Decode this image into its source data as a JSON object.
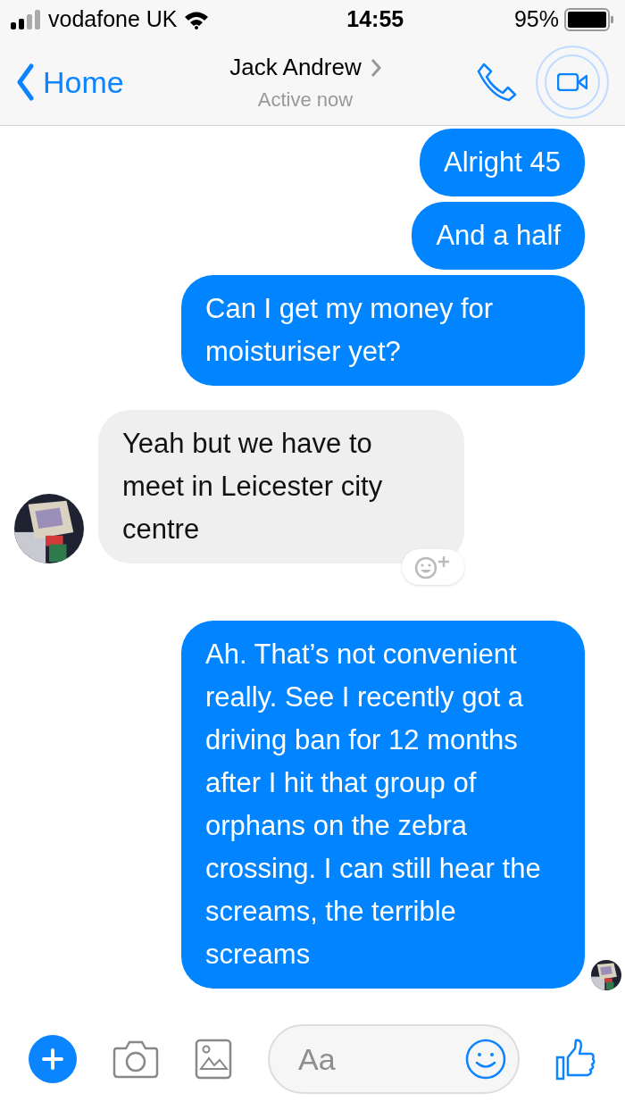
{
  "status_bar": {
    "carrier": "vodafone UK",
    "time": "14:55",
    "battery": "95%"
  },
  "header": {
    "back": "Home",
    "contact": "Jack Andrew",
    "status": "Active now"
  },
  "messages": [
    {
      "kind": "outgoing",
      "text": "Alright 45"
    },
    {
      "kind": "outgoing",
      "text": "And a half"
    },
    {
      "kind": "outgoing",
      "text": "Can I get my money for moisturiser yet?"
    },
    {
      "kind": "incoming",
      "text": "Yeah but we have to meet in Leicester city centre",
      "avatar": true,
      "reaction_button": true
    },
    {
      "kind": "outgoing",
      "text": "Ah. That’s not convenient really. See I recently got a driving ban for 12 months after I hit that group of orphans on the zebra crossing. I can still hear the screams, the terrible screams",
      "seen_avatar": true
    }
  ],
  "composer": {
    "placeholder": "Aa"
  }
}
